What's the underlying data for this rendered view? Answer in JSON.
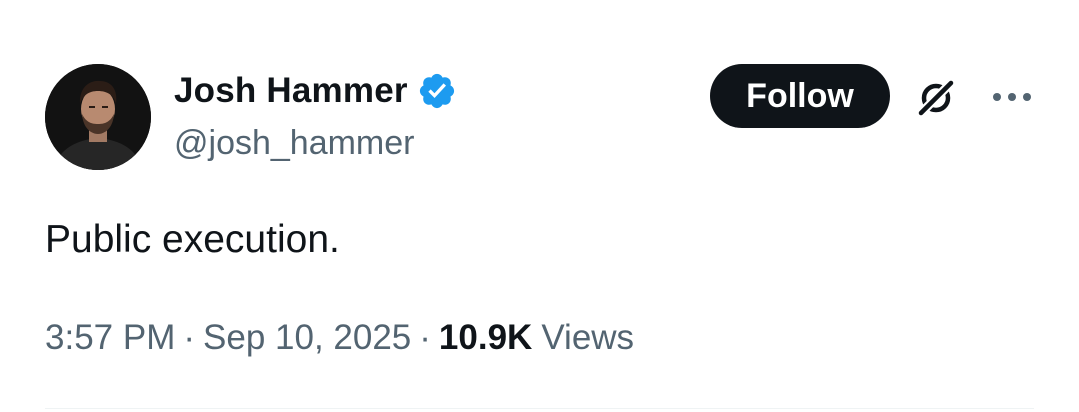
{
  "author": {
    "display_name": "Josh Hammer",
    "handle": "@josh_hammer",
    "verified": true,
    "verified_badge_icon": "verified-badge-icon"
  },
  "actions": {
    "follow_label": "Follow",
    "grok_icon": "grok-icon",
    "more_icon": "more-options-icon"
  },
  "tweet": {
    "text": "Public execution.",
    "time": "3:57 PM",
    "date": "Sep 10, 2025",
    "separator": "·",
    "views_count": "10.9K",
    "views_label": "Views"
  },
  "colors": {
    "text_primary": "#0f1419",
    "text_secondary": "#536471",
    "verified_blue": "#1d9bf0",
    "button_bg": "#0f1419",
    "button_text": "#ffffff",
    "divider": "#eff3f4"
  }
}
